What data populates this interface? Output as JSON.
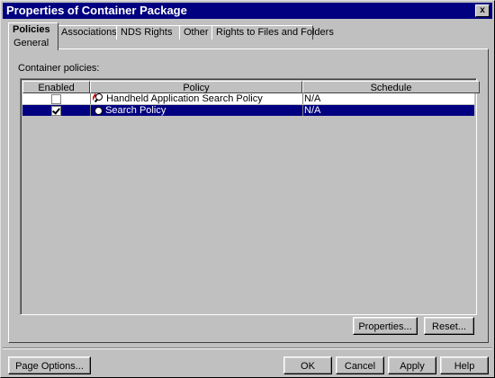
{
  "window": {
    "title": "Properties of Container Package",
    "close_label": "x"
  },
  "tabs": [
    {
      "label": "Policies",
      "active": true,
      "sub": "General"
    },
    {
      "label": "Associations"
    },
    {
      "label": "NDS Rights",
      "has_dropdown": true
    },
    {
      "label": "Other"
    },
    {
      "label": "Rights to Files and Folders"
    }
  ],
  "section": {
    "label": "Container policies:"
  },
  "grid": {
    "headers": [
      "Enabled",
      "Policy",
      "Schedule"
    ],
    "rows": [
      {
        "enabled": false,
        "policy": "Handheld Application Search Policy",
        "schedule": "N/A",
        "icon": "search-policy-icon",
        "selected": false
      },
      {
        "enabled": true,
        "policy": "Search Policy",
        "schedule": "N/A",
        "icon": "policy-dot-icon",
        "selected": true
      }
    ]
  },
  "panel_buttons": {
    "properties": "Properties...",
    "reset": "Reset..."
  },
  "footer_buttons": {
    "page_options": "Page Options...",
    "ok": "OK",
    "cancel": "Cancel",
    "apply": "Apply",
    "help": "Help"
  },
  "colors": {
    "title_bar": "#000080",
    "selection": "#000080",
    "face": "#c0c0c0"
  }
}
